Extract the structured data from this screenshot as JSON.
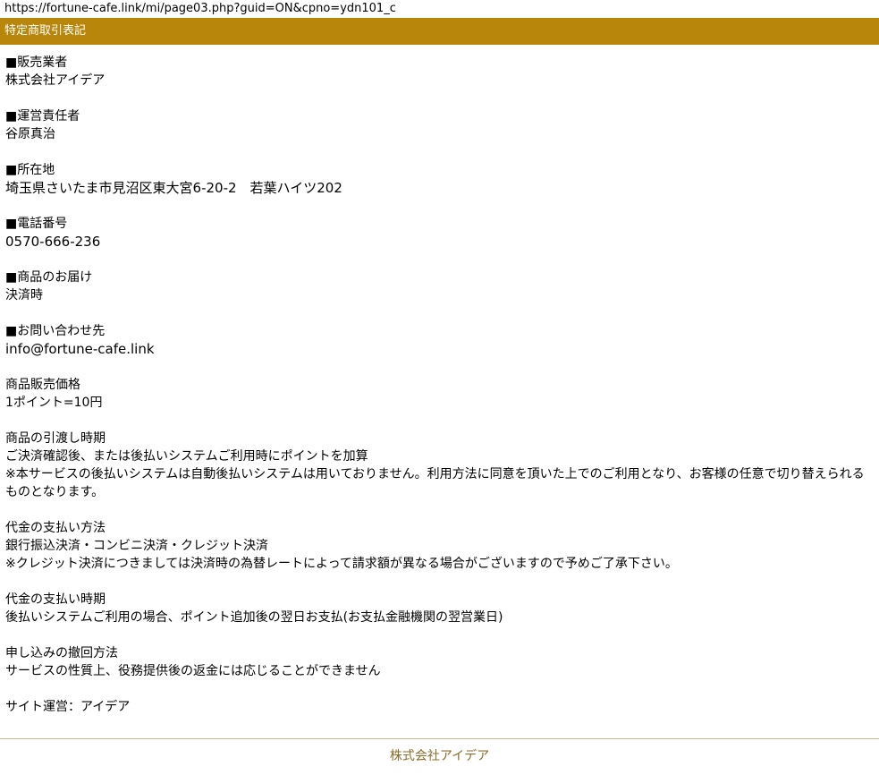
{
  "browser": {
    "url": "https://fortune-cafe.link/mi/page03.php?guid=ON&cpno=ydn101_c"
  },
  "header": {
    "title": "特定商取引表記"
  },
  "colors": {
    "header_bg": "#b8860b",
    "footer_text": "#8a6d2c"
  },
  "sections": {
    "seller": {
      "heading": "■販売業者",
      "lines": [
        "株式会社アイデア"
      ]
    },
    "manager": {
      "heading": "■運営責任者",
      "lines": [
        "谷原真治"
      ]
    },
    "address": {
      "heading": "■所在地",
      "lines": [
        "埼玉県さいたま市見沼区東大宮6-20-2　若葉ハイツ202"
      ]
    },
    "phone": {
      "heading": "■電話番号",
      "lines": [
        "0570-666-236"
      ]
    },
    "delivery": {
      "heading": "■商品のお届け",
      "lines": [
        "決済時"
      ]
    },
    "contact": {
      "heading": "■お問い合わせ先",
      "lines": [
        "info@fortune-cafe.link"
      ]
    },
    "price": {
      "heading": "商品販売価格",
      "lines": [
        "1ポイント=10円"
      ]
    },
    "handover": {
      "heading": "商品の引渡し時期",
      "lines": [
        "ご決済確認後、または後払いシステムご利用時にポイントを加算",
        "※本サービスの後払いシステムは自動後払いシステムは用いておりません。利用方法に同意を頂いた上でのご利用となり、お客様の任意で切り替えられるものとなります。"
      ]
    },
    "payment_method": {
      "heading": "代金の支払い方法",
      "lines": [
        "銀行振込決済・コンビニ決済・クレジット決済",
        "※クレジット決済につきましては決済時の為替レートによって請求額が異なる場合がございますので予めご了承下さい。"
      ]
    },
    "payment_timing": {
      "heading": "代金の支払い時期",
      "lines": [
        "後払いシステムご利用の場合、ポイント追加後の翌日お支払(お支払金融機関の翌営業日)"
      ]
    },
    "withdrawal": {
      "heading": "申し込みの撤回方法",
      "lines": [
        "サービスの性質上、役務提供後の返金には応じることができません"
      ]
    },
    "operator": {
      "heading": "サイト運営：アイデア"
    }
  },
  "footer": {
    "company": "株式会社アイデア"
  }
}
